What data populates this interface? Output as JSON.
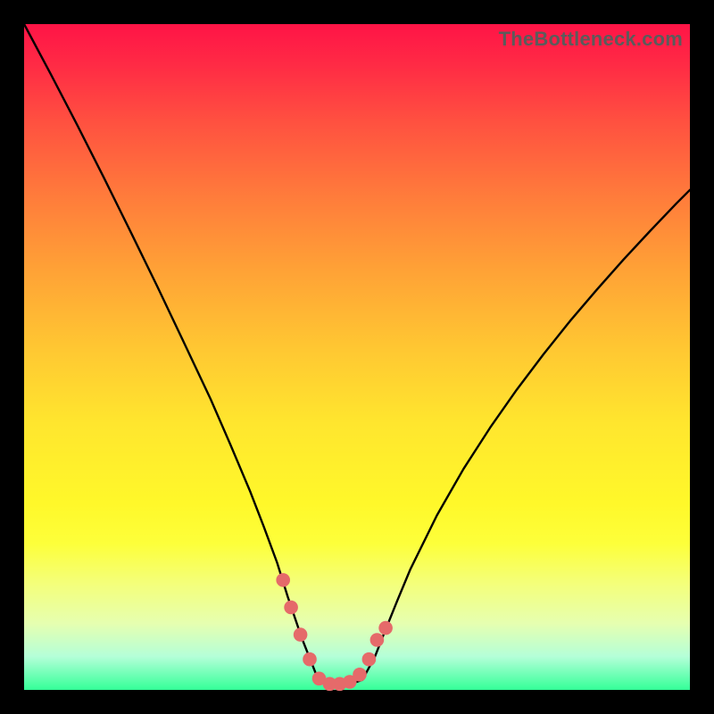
{
  "watermark": {
    "text": "TheBottleneck.com"
  },
  "colors": {
    "background": "#000000",
    "curve_stroke": "#000000",
    "dot_fill": "#e56a6a",
    "gradient_top": "#ff1446",
    "gradient_bottom": "#34ff98"
  },
  "chart_data": {
    "type": "line",
    "title": "",
    "xlabel": "",
    "ylabel": "",
    "xlim": [
      0,
      100
    ],
    "ylim": [
      0,
      100
    ],
    "grid": false,
    "series": [
      {
        "name": "curve",
        "x": [
          0,
          4,
          8,
          12,
          16,
          20,
          24,
          28,
          31,
          34,
          36,
          38,
          39.6,
          41.7,
          44.0,
          46.3,
          48.5,
          50.8,
          52.7,
          54,
          56,
          58,
          62,
          66,
          70,
          74,
          78,
          82,
          86,
          90,
          94,
          98,
          100
        ],
        "values": [
          100,
          92.5,
          84.8,
          76.9,
          68.8,
          60.6,
          52.2,
          43.7,
          36.8,
          29.7,
          24.5,
          19.1,
          14.0,
          7.8,
          2.0,
          0.7,
          0.7,
          1.5,
          5.0,
          8.3,
          13.3,
          18.1,
          26.2,
          33.2,
          39.4,
          45.1,
          50.4,
          55.4,
          60.1,
          64.6,
          68.9,
          73.1,
          75.1
        ]
      }
    ],
    "dots": {
      "name": "markers",
      "x": [
        38.9,
        40.1,
        41.5,
        42.9,
        44.3,
        45.9,
        47.4,
        48.9,
        50.4,
        51.8,
        53.0,
        54.3
      ],
      "values": [
        16.5,
        12.4,
        8.3,
        4.6,
        1.7,
        0.9,
        0.9,
        1.2,
        2.3,
        4.6,
        7.5,
        9.3
      ]
    }
  }
}
